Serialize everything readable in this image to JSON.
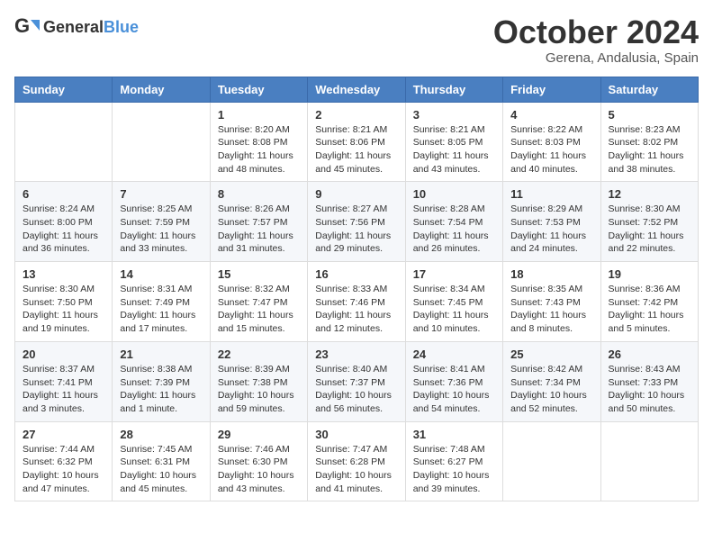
{
  "logo": {
    "text_general": "General",
    "text_blue": "Blue"
  },
  "title": {
    "month": "October 2024",
    "location": "Gerena, Andalusia, Spain"
  },
  "headers": [
    "Sunday",
    "Monday",
    "Tuesday",
    "Wednesday",
    "Thursday",
    "Friday",
    "Saturday"
  ],
  "weeks": [
    [
      {
        "day": "",
        "detail": ""
      },
      {
        "day": "",
        "detail": ""
      },
      {
        "day": "1",
        "detail": "Sunrise: 8:20 AM\nSunset: 8:08 PM\nDaylight: 11 hours and 48 minutes."
      },
      {
        "day": "2",
        "detail": "Sunrise: 8:21 AM\nSunset: 8:06 PM\nDaylight: 11 hours and 45 minutes."
      },
      {
        "day": "3",
        "detail": "Sunrise: 8:21 AM\nSunset: 8:05 PM\nDaylight: 11 hours and 43 minutes."
      },
      {
        "day": "4",
        "detail": "Sunrise: 8:22 AM\nSunset: 8:03 PM\nDaylight: 11 hours and 40 minutes."
      },
      {
        "day": "5",
        "detail": "Sunrise: 8:23 AM\nSunset: 8:02 PM\nDaylight: 11 hours and 38 minutes."
      }
    ],
    [
      {
        "day": "6",
        "detail": "Sunrise: 8:24 AM\nSunset: 8:00 PM\nDaylight: 11 hours and 36 minutes."
      },
      {
        "day": "7",
        "detail": "Sunrise: 8:25 AM\nSunset: 7:59 PM\nDaylight: 11 hours and 33 minutes."
      },
      {
        "day": "8",
        "detail": "Sunrise: 8:26 AM\nSunset: 7:57 PM\nDaylight: 11 hours and 31 minutes."
      },
      {
        "day": "9",
        "detail": "Sunrise: 8:27 AM\nSunset: 7:56 PM\nDaylight: 11 hours and 29 minutes."
      },
      {
        "day": "10",
        "detail": "Sunrise: 8:28 AM\nSunset: 7:54 PM\nDaylight: 11 hours and 26 minutes."
      },
      {
        "day": "11",
        "detail": "Sunrise: 8:29 AM\nSunset: 7:53 PM\nDaylight: 11 hours and 24 minutes."
      },
      {
        "day": "12",
        "detail": "Sunrise: 8:30 AM\nSunset: 7:52 PM\nDaylight: 11 hours and 22 minutes."
      }
    ],
    [
      {
        "day": "13",
        "detail": "Sunrise: 8:30 AM\nSunset: 7:50 PM\nDaylight: 11 hours and 19 minutes."
      },
      {
        "day": "14",
        "detail": "Sunrise: 8:31 AM\nSunset: 7:49 PM\nDaylight: 11 hours and 17 minutes."
      },
      {
        "day": "15",
        "detail": "Sunrise: 8:32 AM\nSunset: 7:47 PM\nDaylight: 11 hours and 15 minutes."
      },
      {
        "day": "16",
        "detail": "Sunrise: 8:33 AM\nSunset: 7:46 PM\nDaylight: 11 hours and 12 minutes."
      },
      {
        "day": "17",
        "detail": "Sunrise: 8:34 AM\nSunset: 7:45 PM\nDaylight: 11 hours and 10 minutes."
      },
      {
        "day": "18",
        "detail": "Sunrise: 8:35 AM\nSunset: 7:43 PM\nDaylight: 11 hours and 8 minutes."
      },
      {
        "day": "19",
        "detail": "Sunrise: 8:36 AM\nSunset: 7:42 PM\nDaylight: 11 hours and 5 minutes."
      }
    ],
    [
      {
        "day": "20",
        "detail": "Sunrise: 8:37 AM\nSunset: 7:41 PM\nDaylight: 11 hours and 3 minutes."
      },
      {
        "day": "21",
        "detail": "Sunrise: 8:38 AM\nSunset: 7:39 PM\nDaylight: 11 hours and 1 minute."
      },
      {
        "day": "22",
        "detail": "Sunrise: 8:39 AM\nSunset: 7:38 PM\nDaylight: 10 hours and 59 minutes."
      },
      {
        "day": "23",
        "detail": "Sunrise: 8:40 AM\nSunset: 7:37 PM\nDaylight: 10 hours and 56 minutes."
      },
      {
        "day": "24",
        "detail": "Sunrise: 8:41 AM\nSunset: 7:36 PM\nDaylight: 10 hours and 54 minutes."
      },
      {
        "day": "25",
        "detail": "Sunrise: 8:42 AM\nSunset: 7:34 PM\nDaylight: 10 hours and 52 minutes."
      },
      {
        "day": "26",
        "detail": "Sunrise: 8:43 AM\nSunset: 7:33 PM\nDaylight: 10 hours and 50 minutes."
      }
    ],
    [
      {
        "day": "27",
        "detail": "Sunrise: 7:44 AM\nSunset: 6:32 PM\nDaylight: 10 hours and 47 minutes."
      },
      {
        "day": "28",
        "detail": "Sunrise: 7:45 AM\nSunset: 6:31 PM\nDaylight: 10 hours and 45 minutes."
      },
      {
        "day": "29",
        "detail": "Sunrise: 7:46 AM\nSunset: 6:30 PM\nDaylight: 10 hours and 43 minutes."
      },
      {
        "day": "30",
        "detail": "Sunrise: 7:47 AM\nSunset: 6:28 PM\nDaylight: 10 hours and 41 minutes."
      },
      {
        "day": "31",
        "detail": "Sunrise: 7:48 AM\nSunset: 6:27 PM\nDaylight: 10 hours and 39 minutes."
      },
      {
        "day": "",
        "detail": ""
      },
      {
        "day": "",
        "detail": ""
      }
    ]
  ]
}
